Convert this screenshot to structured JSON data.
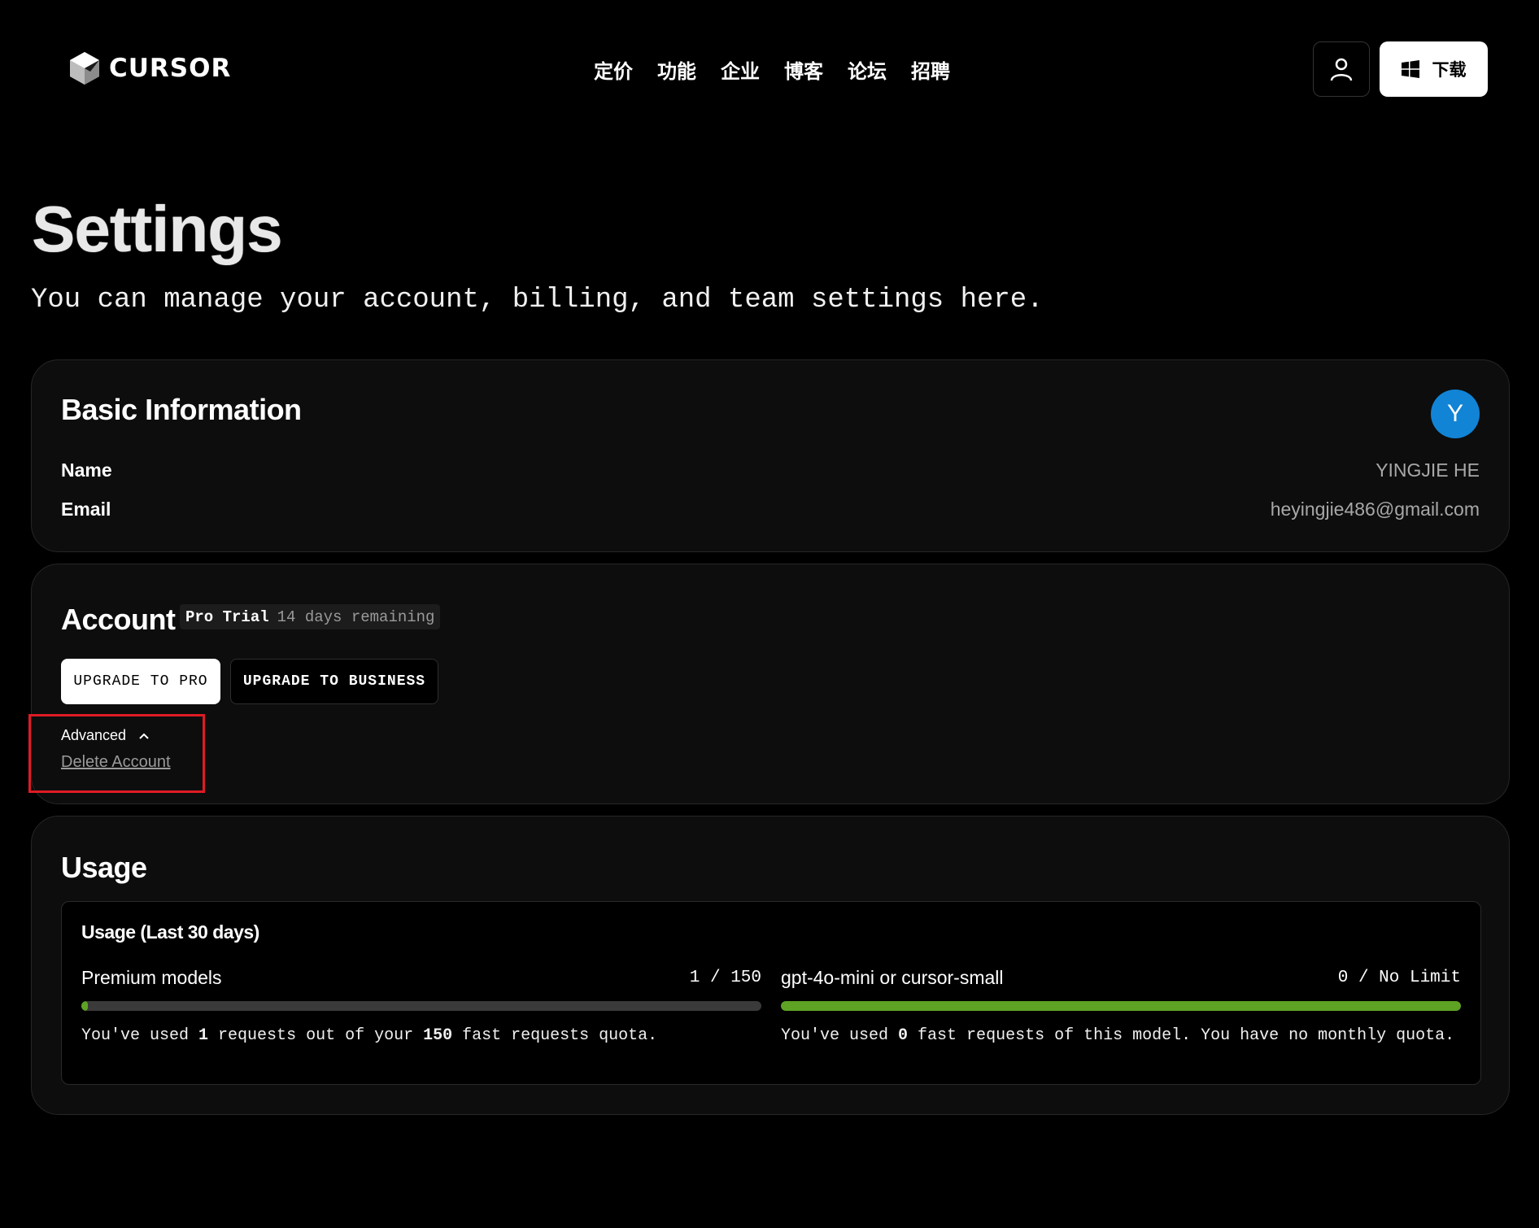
{
  "header": {
    "logo_text": "CURSOR",
    "nav": [
      "定价",
      "功能",
      "企业",
      "博客",
      "论坛",
      "招聘"
    ],
    "download_label": "下载"
  },
  "page": {
    "title": "Settings",
    "subtitle": "You can manage your account, billing, and team settings here."
  },
  "basic_info": {
    "title": "Basic Information",
    "avatar_letter": "Y",
    "avatar_color": "#1184d6",
    "name_label": "Name",
    "name_value": "YINGJIE HE",
    "email_label": "Email",
    "email_value": "heyingjie486@gmail.com"
  },
  "account": {
    "title": "Account",
    "plan_label": "Pro Trial",
    "plan_remaining": "14 days remaining",
    "upgrade_pro_label": "UPGRADE TO PRO",
    "upgrade_business_label": "UPGRADE TO BUSINESS",
    "advanced_label": "Advanced",
    "delete_label": "Delete Account"
  },
  "usage": {
    "title": "Usage",
    "subtitle": "Usage (Last 30 days)",
    "meters": [
      {
        "name": "Premium models",
        "count": "1 / 150",
        "fill_fraction": 0.0067,
        "desc_prefix": "You've used ",
        "desc_used": "1",
        "desc_mid": " requests out of your ",
        "desc_total": "150",
        "desc_suffix": " fast requests quota."
      },
      {
        "name": "gpt-4o-mini or cursor-small",
        "count": "0 / No Limit",
        "fill_fraction": 1.0,
        "desc_prefix": "You've used ",
        "desc_used": "0",
        "desc_suffix": " fast requests of this model. You have no monthly quota."
      }
    ],
    "accent_color": "#5ea324"
  }
}
